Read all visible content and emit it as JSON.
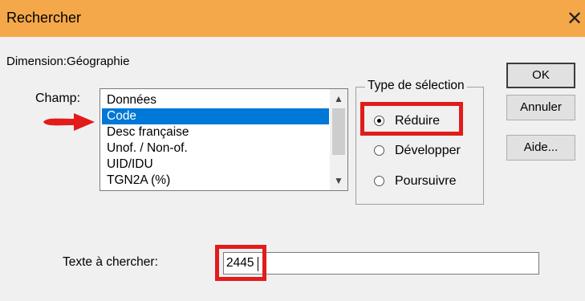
{
  "window": {
    "title": "Rechercher",
    "close_glyph": "✕",
    "titlebar_color": "#f5a84a"
  },
  "dimension_label": "Dimension:Géographie",
  "champ": {
    "label": "Champ:",
    "items": [
      {
        "label": "Données",
        "selected": false
      },
      {
        "label": "Code",
        "selected": true
      },
      {
        "label": "Desc française",
        "selected": false
      },
      {
        "label": "Unof. / Non-of.",
        "selected": false
      },
      {
        "label": "UID/IDU",
        "selected": false
      },
      {
        "label": "TGN2A (%)",
        "selected": false
      }
    ],
    "selection_color": "#0078d7"
  },
  "selection_type": {
    "legend": "Type de sélection",
    "options": [
      {
        "label": "Réduire",
        "checked": true
      },
      {
        "label": "Développer",
        "checked": false
      },
      {
        "label": "Poursuivre",
        "checked": false
      }
    ]
  },
  "buttons": {
    "ok": "OK",
    "cancel": "Annuler",
    "help": "Aide..."
  },
  "search": {
    "label": "Texte à chercher:",
    "value": "2445"
  },
  "annotations": {
    "highlight_color": "#e21b1b",
    "arrow_icon": "red-arrow-icon"
  }
}
